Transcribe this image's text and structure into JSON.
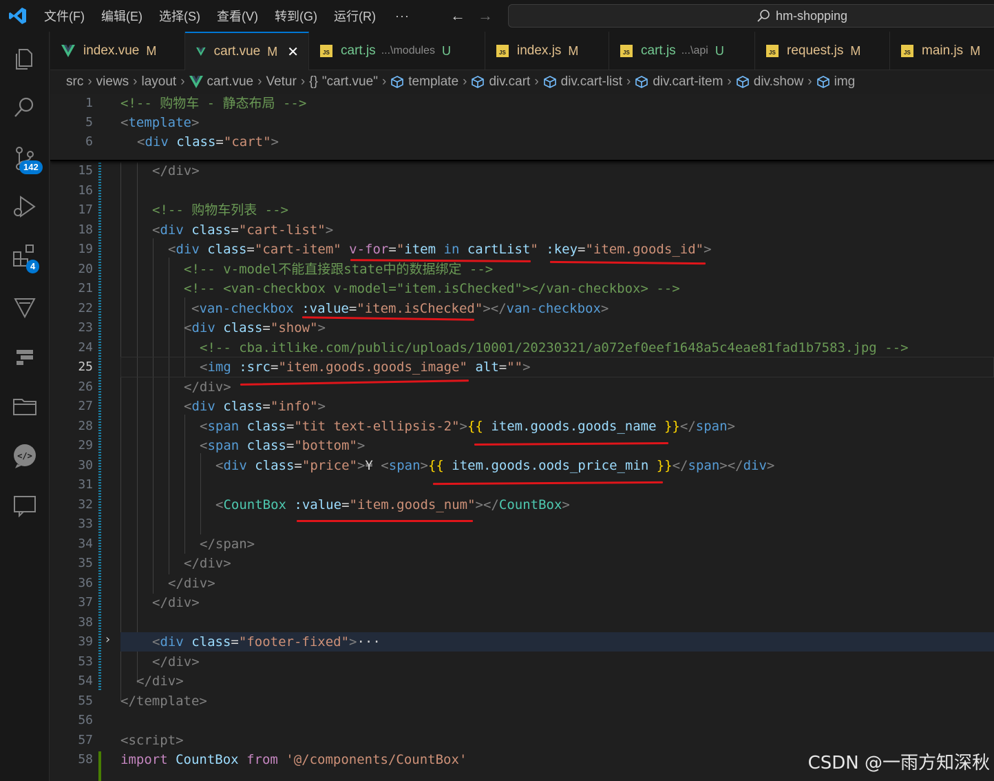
{
  "titlebar": {
    "menu": [
      "文件(F)",
      "编辑(E)",
      "选择(S)",
      "查看(V)",
      "转到(G)",
      "运行(R)"
    ],
    "more": "···",
    "back": "←",
    "forward": "→",
    "search_text": "hm-shopping"
  },
  "activity": {
    "scm_badge": "142",
    "extensions_badge": "4"
  },
  "tabs": [
    {
      "name": "index.vue",
      "path": "",
      "status": "M",
      "icon": "vue"
    },
    {
      "name": "cart.vue",
      "path": "",
      "status": "M",
      "icon": "vue",
      "close": "✕"
    },
    {
      "name": "cart.js",
      "path": "...\\modules",
      "status": "U",
      "icon": "js"
    },
    {
      "name": "index.js",
      "path": "",
      "status": "M",
      "icon": "js"
    },
    {
      "name": "cart.js",
      "path": "...\\api",
      "status": "U",
      "icon": "js"
    },
    {
      "name": "request.js",
      "path": "",
      "status": "M",
      "icon": "js"
    },
    {
      "name": "main.js",
      "path": "",
      "status": "M",
      "icon": "js"
    }
  ],
  "breadcrumb": {
    "src": "src",
    "views": "views",
    "layout": "layout",
    "file": "cart.vue",
    "vetur": "Vetur",
    "braces": "{}",
    "quoted": "\"cart.vue\"",
    "template": "template",
    "div_cart": "div.cart",
    "div_cart_list": "div.cart-list",
    "div_cart_item": "div.cart-item",
    "div_show": "div.show",
    "img": "img"
  },
  "sticky_lines": [
    "1",
    "5",
    "6"
  ],
  "line_numbers": [
    "15",
    "16",
    "17",
    "18",
    "19",
    "20",
    "21",
    "22",
    "23",
    "24",
    "25",
    "26",
    "27",
    "28",
    "29",
    "30",
    "31",
    "32",
    "33",
    "34",
    "35",
    "36",
    "37",
    "38",
    "39",
    "53",
    "54",
    "55",
    "56",
    "57",
    "58"
  ],
  "code": {
    "l1": "<!-- 购物车 - 静态布局 -->",
    "l5_open": "<",
    "l5_name": "template",
    "l5_close": ">",
    "l6": {
      "open": "<",
      "name": "div",
      "attr": " class",
      "eq": "=",
      "val": "\"cart\"",
      "close": ">"
    },
    "l15": "</div>",
    "l17": "<!-- 购物车列表 -->",
    "l18": {
      "name": "div",
      "attr": " class",
      "val": "\"cart-list\""
    },
    "l19": {
      "name": "div",
      "attr1": " class",
      "val1": "\"cart-item\"",
      "attr2": "v-for",
      "val2a": "\"",
      "val2b": "item",
      "kw": "in",
      "val2c": "cartList",
      "val2d": "\"",
      "attr3": ":key",
      "val3": "\"item.goods_id\""
    },
    "l20": "<!-- v-model不能直接跟state中的数据绑定 -->",
    "l21": "<!-- <van-checkbox v-model=\"item.isChecked\"></van-checkbox> -->",
    "l22": {
      "name": "van-checkbox",
      "attr": ":value",
      "val": "\"item.isChecked\"",
      "close_name": "van-checkbox"
    },
    "l23": {
      "name": "div",
      "attr": " class",
      "val": "\"show\""
    },
    "l24": "<!-- cba.itlike.com/public/uploads/10001/20230321/a072ef0eef1648a5c4eae81fad1b7583.jpg -->",
    "l25": {
      "name": "img",
      "attr1": ":src",
      "val1": "\"item.goods.goods_image\"",
      "attr2": "alt",
      "val2": "\"\""
    },
    "l26": "</div>",
    "l27": {
      "name": "div",
      "attr": " class",
      "val": "\"info\""
    },
    "l28": {
      "name": "span",
      "attr": " class",
      "val": "\"tit text-ellipsis-2\"",
      "expr": " item.goods.goods_name "
    },
    "l29": {
      "name": "span",
      "attr": " class",
      "val": "\"bottom\""
    },
    "l30": {
      "name": "div",
      "attr": " class",
      "val": "\"price\"",
      "yen": "¥ ",
      "inner": "span",
      "expr": " item.goods.oods_price_min "
    },
    "l32": {
      "name": "CountBox",
      "attr": ":value",
      "val": "\"item.goods_num\""
    },
    "l34": "</span>",
    "l35": "</div>",
    "l36": "</div>",
    "l37": "</div>",
    "l39": {
      "name": "div",
      "attr": " class",
      "val": "\"footer-fixed\"",
      "ellipsis": "···"
    },
    "l53": "</div>",
    "l54": "</div>",
    "l55": "</template>",
    "l57": "<script>",
    "l58": {
      "kw": "import",
      "ident": "CountBox",
      "from": "from",
      "str": "'@/components/CountBox'"
    }
  },
  "watermark": "CSDN @一雨方知深秋",
  "colors": {
    "accent": "#0078d4",
    "underline": "#e0151a",
    "modified": "#e2c08d",
    "untracked": "#73c991"
  }
}
